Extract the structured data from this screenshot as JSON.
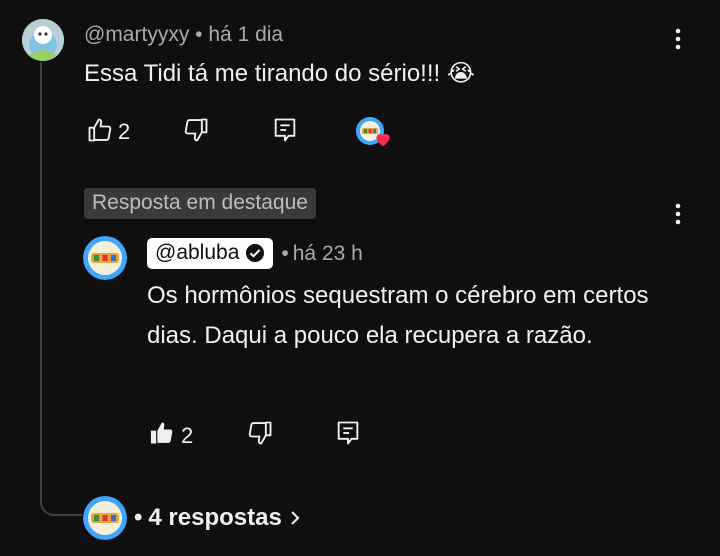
{
  "comment": {
    "author": "@martyyxy",
    "separator": "•",
    "time": "há 1 dia",
    "text": "Essa Tidi tá me tirando do sério!!!",
    "emoji": "😭",
    "likes": "2"
  },
  "pinned_reply": {
    "badge": "Resposta em destaque",
    "author": "@abluba",
    "separator": "•",
    "time": "há 23 h",
    "text": "Os hormônios sequestram o cérebro em certos dias. Daqui a pouco ela recupera a razão.",
    "likes": "2"
  },
  "replies": {
    "label": "4 respostas",
    "separator": "•"
  },
  "colors": {
    "background": "#0f0f0f",
    "heart": "#ff2b4e",
    "avatar_blue": "#3ea6ff"
  }
}
